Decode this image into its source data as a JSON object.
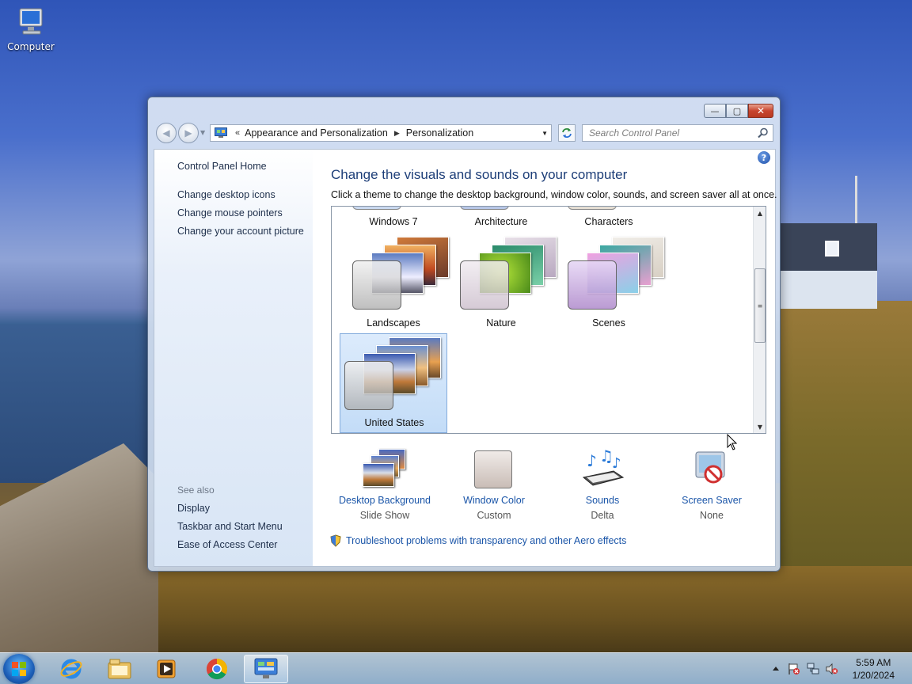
{
  "desktop": {
    "icons": [
      {
        "label": "Computer",
        "icon": "computer-icon"
      }
    ]
  },
  "window": {
    "caption_buttons": {
      "minimize": "—",
      "maximize": "▢",
      "close": "✕"
    },
    "address": {
      "overflow": "«",
      "crumbs": [
        "Appearance and Personalization",
        "Personalization"
      ]
    },
    "search": {
      "placeholder": "Search Control Panel"
    },
    "left": {
      "links": [
        "Control Panel Home",
        "Change desktop icons",
        "Change mouse pointers",
        "Change your account picture"
      ],
      "see_also_title": "See also",
      "see_also": [
        "Display",
        "Taskbar and Start Menu",
        "Ease of Access Center"
      ]
    },
    "main": {
      "heading": "Change the visuals and sounds on your computer",
      "subhead": "Click a theme to change the desktop background, window color, sounds, and screen saver all at once.",
      "themes": [
        {
          "name": "Windows 7"
        },
        {
          "name": "Architecture"
        },
        {
          "name": "Characters"
        },
        {
          "name": "Landscapes"
        },
        {
          "name": "Nature"
        },
        {
          "name": "Scenes"
        },
        {
          "name": "United States",
          "selected": true
        }
      ],
      "settings": [
        {
          "label": "Desktop Background",
          "value": "Slide Show",
          "icon": "desktop-background-icon"
        },
        {
          "label": "Window Color",
          "value": "Custom",
          "icon": "window-color-icon"
        },
        {
          "label": "Sounds",
          "value": "Delta",
          "icon": "sounds-icon"
        },
        {
          "label": "Screen Saver",
          "value": "None",
          "icon": "screen-saver-icon"
        }
      ],
      "troubleshoot": "Troubleshoot problems with transparency and other Aero effects"
    }
  },
  "taskbar": {
    "pinned": [
      "internet-explorer-icon",
      "file-explorer-icon",
      "media-player-icon",
      "chrome-icon",
      "control-panel-icon"
    ],
    "active": "control-panel-icon",
    "clock": {
      "time": "5:59 AM",
      "date": "1/20/2024"
    }
  },
  "colors": {
    "accent": "#1d3e78",
    "link": "#1a55a8",
    "selection": "#c3dcf7"
  }
}
